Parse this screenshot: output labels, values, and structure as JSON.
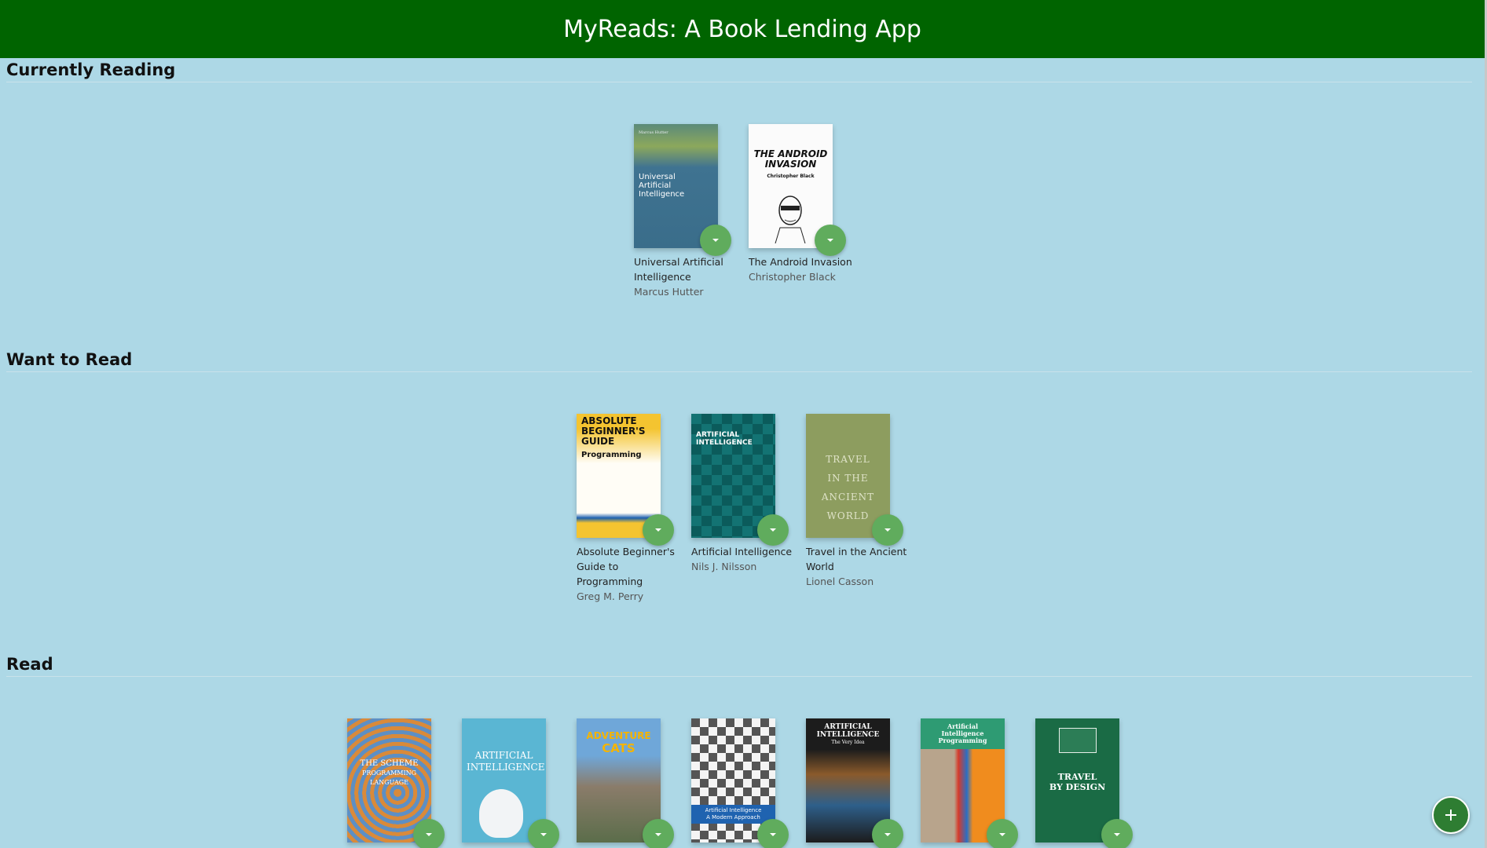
{
  "app": {
    "title": "MyReads: A Book Lending App"
  },
  "colors": {
    "header": "#006400",
    "background": "#add8e6",
    "changer": "#60ac5d",
    "add": "#2e7d32"
  },
  "shelves": [
    {
      "title": "Currently Reading",
      "books": [
        {
          "title": "Universal Artificial Intelligence",
          "authors": "Marcus Hutter",
          "cover_text": [
            "Universal",
            "Artificial Intelligence"
          ]
        },
        {
          "title": "The Android Invasion",
          "authors": "Christopher Black",
          "cover_text": [
            "THE ANDROID",
            "INVASION",
            "Christopher Black"
          ]
        }
      ]
    },
    {
      "title": "Want to Read",
      "books": [
        {
          "title": "Absolute Beginner's Guide to Programming",
          "authors": "Greg M. Perry",
          "cover_text": [
            "ABSOLUTE",
            "BEGINNER'S",
            "GUIDE",
            "Programming"
          ]
        },
        {
          "title": "Artificial Intelligence",
          "authors": "Nils J. Nilsson",
          "cover_text": [
            "ARTIFICIAL",
            "INTELLIGENCE"
          ]
        },
        {
          "title": "Travel in the Ancient World",
          "authors": "Lionel Casson",
          "cover_text": [
            "TRAVEL",
            "IN THE",
            "ANCIENT",
            "WORLD"
          ]
        }
      ]
    },
    {
      "title": "Read",
      "books": [
        {
          "cover_text": [
            "THE SCHEME",
            "PROGRAMMING",
            "LANGUAGE"
          ]
        },
        {
          "cover_text": [
            "ARTIFICIAL",
            "INTELLIGENCE"
          ]
        },
        {
          "cover_text": [
            "ADVENTURE",
            "CATS"
          ]
        },
        {
          "cover_text": [
            "Artificial Intelligence",
            "A Modern Approach"
          ]
        },
        {
          "cover_text": [
            "ARTIFICIAL",
            "INTELLIGENCE",
            "The Very Idea"
          ]
        },
        {
          "cover_text": [
            "Artificial",
            "Intelligence",
            "Programming"
          ]
        },
        {
          "cover_text": [
            "TRAVEL",
            "BY DESIGN"
          ]
        }
      ]
    }
  ],
  "icons": {
    "shelf_changer": "chevron-down-icon",
    "add": "plus-icon"
  }
}
